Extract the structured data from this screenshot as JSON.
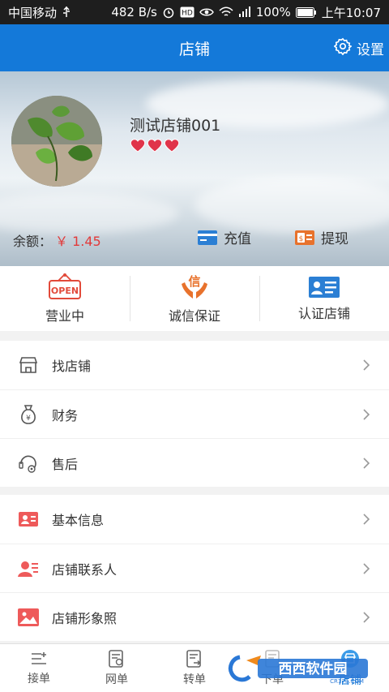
{
  "status_bar": {
    "carrier": "中国移动",
    "speed": "482 B/s",
    "battery": "100%",
    "time": "上午10:07"
  },
  "header": {
    "title": "店铺",
    "settings_label": "设置"
  },
  "profile": {
    "shop_name": "测试店铺001",
    "hearts": 3,
    "balance_label": "余额：",
    "balance_value": "￥ 1.45",
    "recharge_label": "充值",
    "withdraw_label": "提现"
  },
  "quick_actions": [
    {
      "label": "营业中",
      "icon": "open-sign-icon"
    },
    {
      "label": "诚信保证",
      "icon": "integrity-hands-icon"
    },
    {
      "label": "认证店铺",
      "icon": "id-card-icon"
    }
  ],
  "menu_group_1": [
    {
      "label": "找店铺",
      "icon": "shop-icon"
    },
    {
      "label": "财务",
      "icon": "money-bag-icon"
    },
    {
      "label": "售后",
      "icon": "after-sale-icon"
    }
  ],
  "menu_group_2": [
    {
      "label": "基本信息",
      "icon": "info-card-icon"
    },
    {
      "label": "店铺联系人",
      "icon": "contact-icon"
    },
    {
      "label": "店铺形象照",
      "icon": "image-icon"
    }
  ],
  "tab_bar": [
    {
      "label": "接单",
      "icon": "accept-order-icon"
    },
    {
      "label": "网单",
      "icon": "web-order-icon"
    },
    {
      "label": "转单",
      "icon": "transfer-order-icon"
    },
    {
      "label": "下单",
      "icon": "place-order-icon"
    },
    {
      "label": "店铺",
      "icon": "shop-tab-icon"
    }
  ],
  "watermark": {
    "brand": "西西软件园",
    "url": "CR173.COM"
  },
  "colors": {
    "primary": "#1479d9",
    "price_red": "#e23a3a",
    "heart_red": "#e0344a",
    "orange": "#e8722c"
  }
}
